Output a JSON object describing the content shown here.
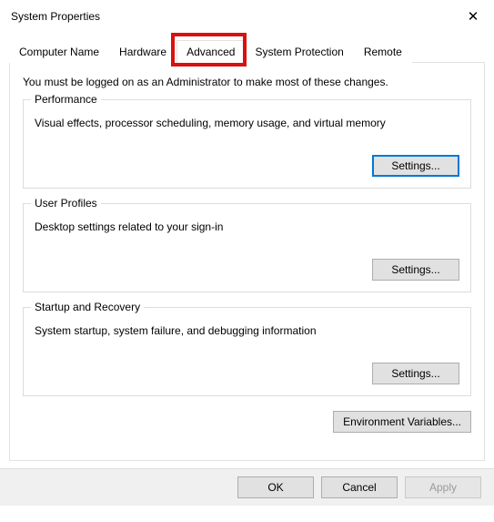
{
  "window": {
    "title": "System Properties",
    "close_glyph": "✕"
  },
  "tabs": {
    "computer_name": "Computer Name",
    "hardware": "Hardware",
    "advanced": "Advanced",
    "system_protection": "System Protection",
    "remote": "Remote"
  },
  "notice": "You must be logged on as an Administrator to make most of these changes.",
  "groups": {
    "performance": {
      "legend": "Performance",
      "desc": "Visual effects, processor scheduling, memory usage, and virtual memory",
      "button": "Settings..."
    },
    "user_profiles": {
      "legend": "User Profiles",
      "desc": "Desktop settings related to your sign-in",
      "button": "Settings..."
    },
    "startup": {
      "legend": "Startup and Recovery",
      "desc": "System startup, system failure, and debugging information",
      "button": "Settings..."
    }
  },
  "env_button": "Environment Variables...",
  "footer": {
    "ok": "OK",
    "cancel": "Cancel",
    "apply": "Apply"
  }
}
